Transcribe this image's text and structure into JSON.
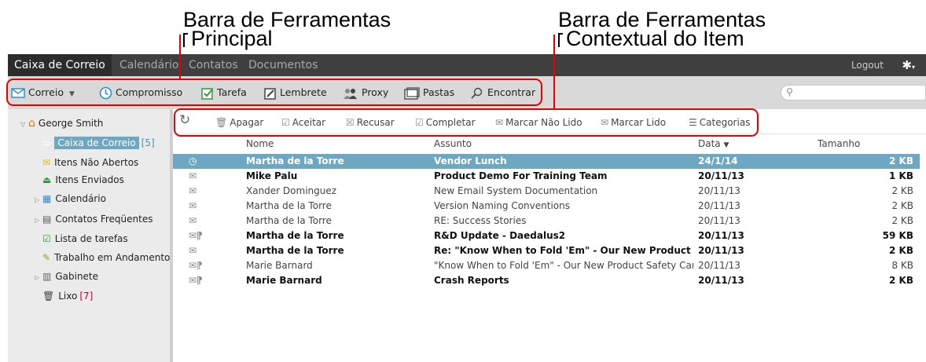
{
  "annotations": {
    "main_toolbar": {
      "line1": "Barra de Ferramentas",
      "line2": "Principal"
    },
    "context_toolbar": {
      "line1": "Barra de Ferramentas",
      "line2": "Contextual do Item"
    },
    "highlight_color": "#e60000"
  },
  "topnav": {
    "tabs": [
      "Caixa de Correio",
      "Calendário",
      "Contatos",
      "Documentos"
    ],
    "active_tab": "Caixa de Correio",
    "logout": "Logout",
    "settings_icon": "gear-icon"
  },
  "main_toolbar": {
    "mail": "Correio",
    "appointment": "Compromisso",
    "task": "Tarefa",
    "reminder": "Lembrete",
    "proxy": "Proxy",
    "folders": "Pastas",
    "find": "Encontrar",
    "search_placeholder": ""
  },
  "sidebar": {
    "account": "George Smith",
    "folders": [
      {
        "label": "Caixa de Correio",
        "count": "[5]",
        "selected": true,
        "icon": "mailbox-icon"
      },
      {
        "label": "Itens Não Abertos",
        "count": "",
        "icon": "unopened-envelope-icon"
      },
      {
        "label": "Itens Enviados",
        "count": "",
        "icon": "sent-items-icon"
      },
      {
        "label": "Calendário",
        "count": "",
        "expandable": true,
        "icon": "calendar-icon"
      },
      {
        "label": "Contatos Freqüentes",
        "count": "",
        "expandable": true,
        "icon": "contacts-icon"
      },
      {
        "label": "Lista de tarefas",
        "count": "",
        "icon": "tasklist-icon"
      },
      {
        "label": "Trabalho em Andamento",
        "count": "",
        "icon": "work-in-progress-icon"
      },
      {
        "label": "Gabinete",
        "count": "",
        "expandable": true,
        "icon": "cabinet-icon"
      },
      {
        "label": "Lixo",
        "count": "[7]",
        "icon": "trash-icon"
      }
    ]
  },
  "context_toolbar": {
    "delete": "Apagar",
    "accept": "Aceitar",
    "decline": "Recusar",
    "complete": "Completar",
    "mark_unread": "Marcar Não Lido",
    "mark_read": "Marcar Lido",
    "categories": "Categorias"
  },
  "message_list": {
    "columns": {
      "from": "Nome",
      "subject": "Assunto",
      "date": "Data",
      "size": "Tamanho"
    },
    "sort_column": "Data",
    "rows": [
      {
        "icon": "clock-icon",
        "from": "Martha de la Torre",
        "subject": "Vendor Lunch",
        "date": "24/1/14",
        "size": "2 KB",
        "unread": true,
        "selected": true
      },
      {
        "icon": "envelope-icon",
        "from": "Mike Palu",
        "subject": "Product Demo For Training Team",
        "date": "20/11/13",
        "size": "1 KB",
        "unread": true,
        "selected": false
      },
      {
        "icon": "opened-envelope-icon",
        "from": "Xander Dominguez",
        "subject": "New Email System Documentation",
        "date": "20/11/13",
        "size": "2 KB",
        "unread": false,
        "selected": false
      },
      {
        "icon": "opened-envelope-icon",
        "from": "Martha de la Torre",
        "subject": "Version Naming Conventions",
        "date": "20/11/13",
        "size": "2 KB",
        "unread": false,
        "selected": false
      },
      {
        "icon": "opened-envelope-icon",
        "from": "Martha de la Torre",
        "subject": "RE: Success Stories",
        "date": "20/11/13",
        "size": "2 KB",
        "unread": false,
        "selected": false
      },
      {
        "icon": "envelope-attachment-icon",
        "from": "Martha de la Torre",
        "subject": "R&D Update - Daedalus2",
        "date": "20/11/13",
        "size": "59 KB",
        "unread": true,
        "selected": false
      },
      {
        "icon": "envelope-icon",
        "from": "Martha de la Torre",
        "subject": "Re: \"Know When to Fold 'Em\" - Our New Product Safety",
        "date": "20/11/13",
        "size": "2 KB",
        "unread": true,
        "selected": false
      },
      {
        "icon": "opened-envelope-attachment-icon",
        "from": "Marie Barnard",
        "subject": "\"Know When to Fold 'Em\" - Our New Product Safety Campa",
        "date": "20/11/13",
        "size": "8 KB",
        "unread": false,
        "selected": false
      },
      {
        "icon": "envelope-attachment-icon",
        "from": "Marie Barnard",
        "subject": "Crash Reports",
        "date": "20/11/13",
        "size": "2 KB",
        "unread": true,
        "selected": false
      }
    ]
  },
  "colors": {
    "topbar": "#3f3f3f",
    "toolbar": "#d9d9d9",
    "sidebar": "#ebebeb",
    "selection": "#6ea7c2",
    "unread_count": "#4a8fb0",
    "trash_count": "#cc0033"
  }
}
